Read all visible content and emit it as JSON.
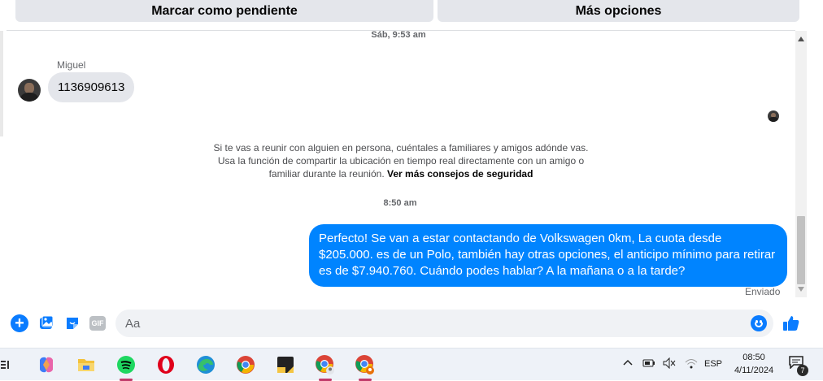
{
  "top_buttons": {
    "mark_pending": "Marcar como pendiente",
    "more_options": "Más opciones"
  },
  "chat": {
    "timestamp_top": "Sáb, 9:53 am",
    "incoming": {
      "sender": "Miguel",
      "text": "1136909613"
    },
    "safety": {
      "text": "Si te vas a reunir con alguien en persona, cuéntales a familiares y amigos adónde vas. Usa la función de compartir la ubicación en tiempo real directamente con un amigo o familiar durante la reunión. ",
      "link": "Ver más consejos de seguridad"
    },
    "timestamp_mid": "8:50 am",
    "outgoing": {
      "text": "Perfecto!  Se van a estar contactando de Volkswagen 0km, La cuota desde $205.000. es de un Polo, también hay otras opciones, el anticipo mínimo para retirar es de $7.940.760. Cuándo podes hablar? A la mañana o a la tarde?",
      "status": "Enviado"
    }
  },
  "composer": {
    "placeholder": "Aa",
    "gif_label": "GIF",
    "accent": "#0a7cff"
  },
  "taskbar": {
    "apps": [
      "copilot-icon",
      "file-explorer-icon",
      "spotify-icon",
      "opera-icon",
      "edge-icon",
      "chrome-icon",
      "sticky-notes-icon",
      "chrome-profile-icon",
      "chrome-profile-icon"
    ],
    "language": "ESP",
    "time": "08:50",
    "date": "4/11/2024",
    "notifications": "7"
  },
  "colors": {
    "outgoing_bubble": "#0084ff",
    "incoming_bubble": "#e4e6eb"
  }
}
